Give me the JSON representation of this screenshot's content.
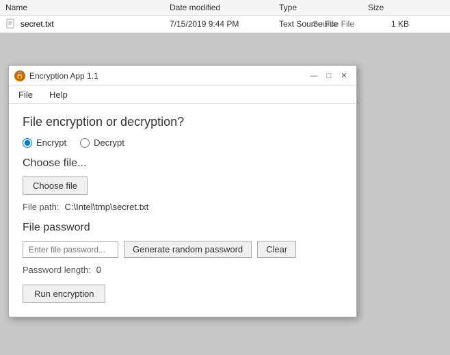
{
  "explorer": {
    "columns": {
      "name": "Name",
      "date_modified": "Date modified",
      "type": "Type",
      "size": "Size"
    },
    "rows": [
      {
        "name": "secret.txt",
        "date_modified": "7/15/2019 9:44 PM",
        "type": "Text Source File",
        "size": "1 KB"
      }
    ],
    "source_file_label": "Source File"
  },
  "app": {
    "title": "Encryption App 1.1",
    "icon_label": "🔒",
    "menu": {
      "file": "File",
      "help": "Help"
    },
    "title_controls": {
      "minimize": "—",
      "maximize": "□",
      "close": "✕"
    },
    "main_title": "File encryption or decryption?",
    "encrypt_label": "Encrypt",
    "decrypt_label": "Decrypt",
    "encrypt_checked": true,
    "decrypt_checked": false,
    "choose_section_title": "Choose file...",
    "choose_btn_label": "Choose file",
    "file_path_label": "File path:",
    "file_path_value": "C:\\Intel\\tmp\\secret.txt",
    "password_section_title": "File password",
    "password_placeholder": "Enter file password...",
    "generate_btn_label": "Generate random password",
    "clear_btn_label": "Clear",
    "password_length_label": "Password length:",
    "password_length_value": "0",
    "run_btn_label": "Run encryption"
  }
}
